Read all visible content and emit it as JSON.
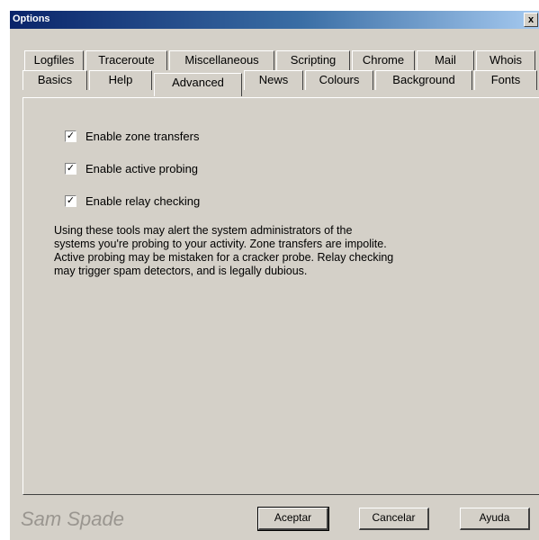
{
  "window": {
    "title": "Options",
    "close_label": "x"
  },
  "tabs_row1": [
    "Logfiles",
    "Traceroute",
    "Miscellaneous",
    "Scripting",
    "Chrome",
    "Mail",
    "Whois"
  ],
  "tabs_row2": [
    "Basics",
    "Help",
    "Advanced",
    "News",
    "Colours",
    "Background",
    "Fonts"
  ],
  "active_tab": "Advanced",
  "options": [
    {
      "label": "Enable zone transfers",
      "checked": true
    },
    {
      "label": "Enable active probing",
      "checked": true
    },
    {
      "label": "Enable relay checking",
      "checked": true
    }
  ],
  "warning_text": "Using these tools may alert the system administrators of the systems you're probing to your activity. Zone transfers are impolite. Active probing may be mistaken for a cracker probe. Relay checking may trigger spam detectors, and is legally dubious.",
  "brand": "Sam Spade",
  "buttons": {
    "accept": "Aceptar",
    "cancel": "Cancelar",
    "help": "Ayuda"
  }
}
